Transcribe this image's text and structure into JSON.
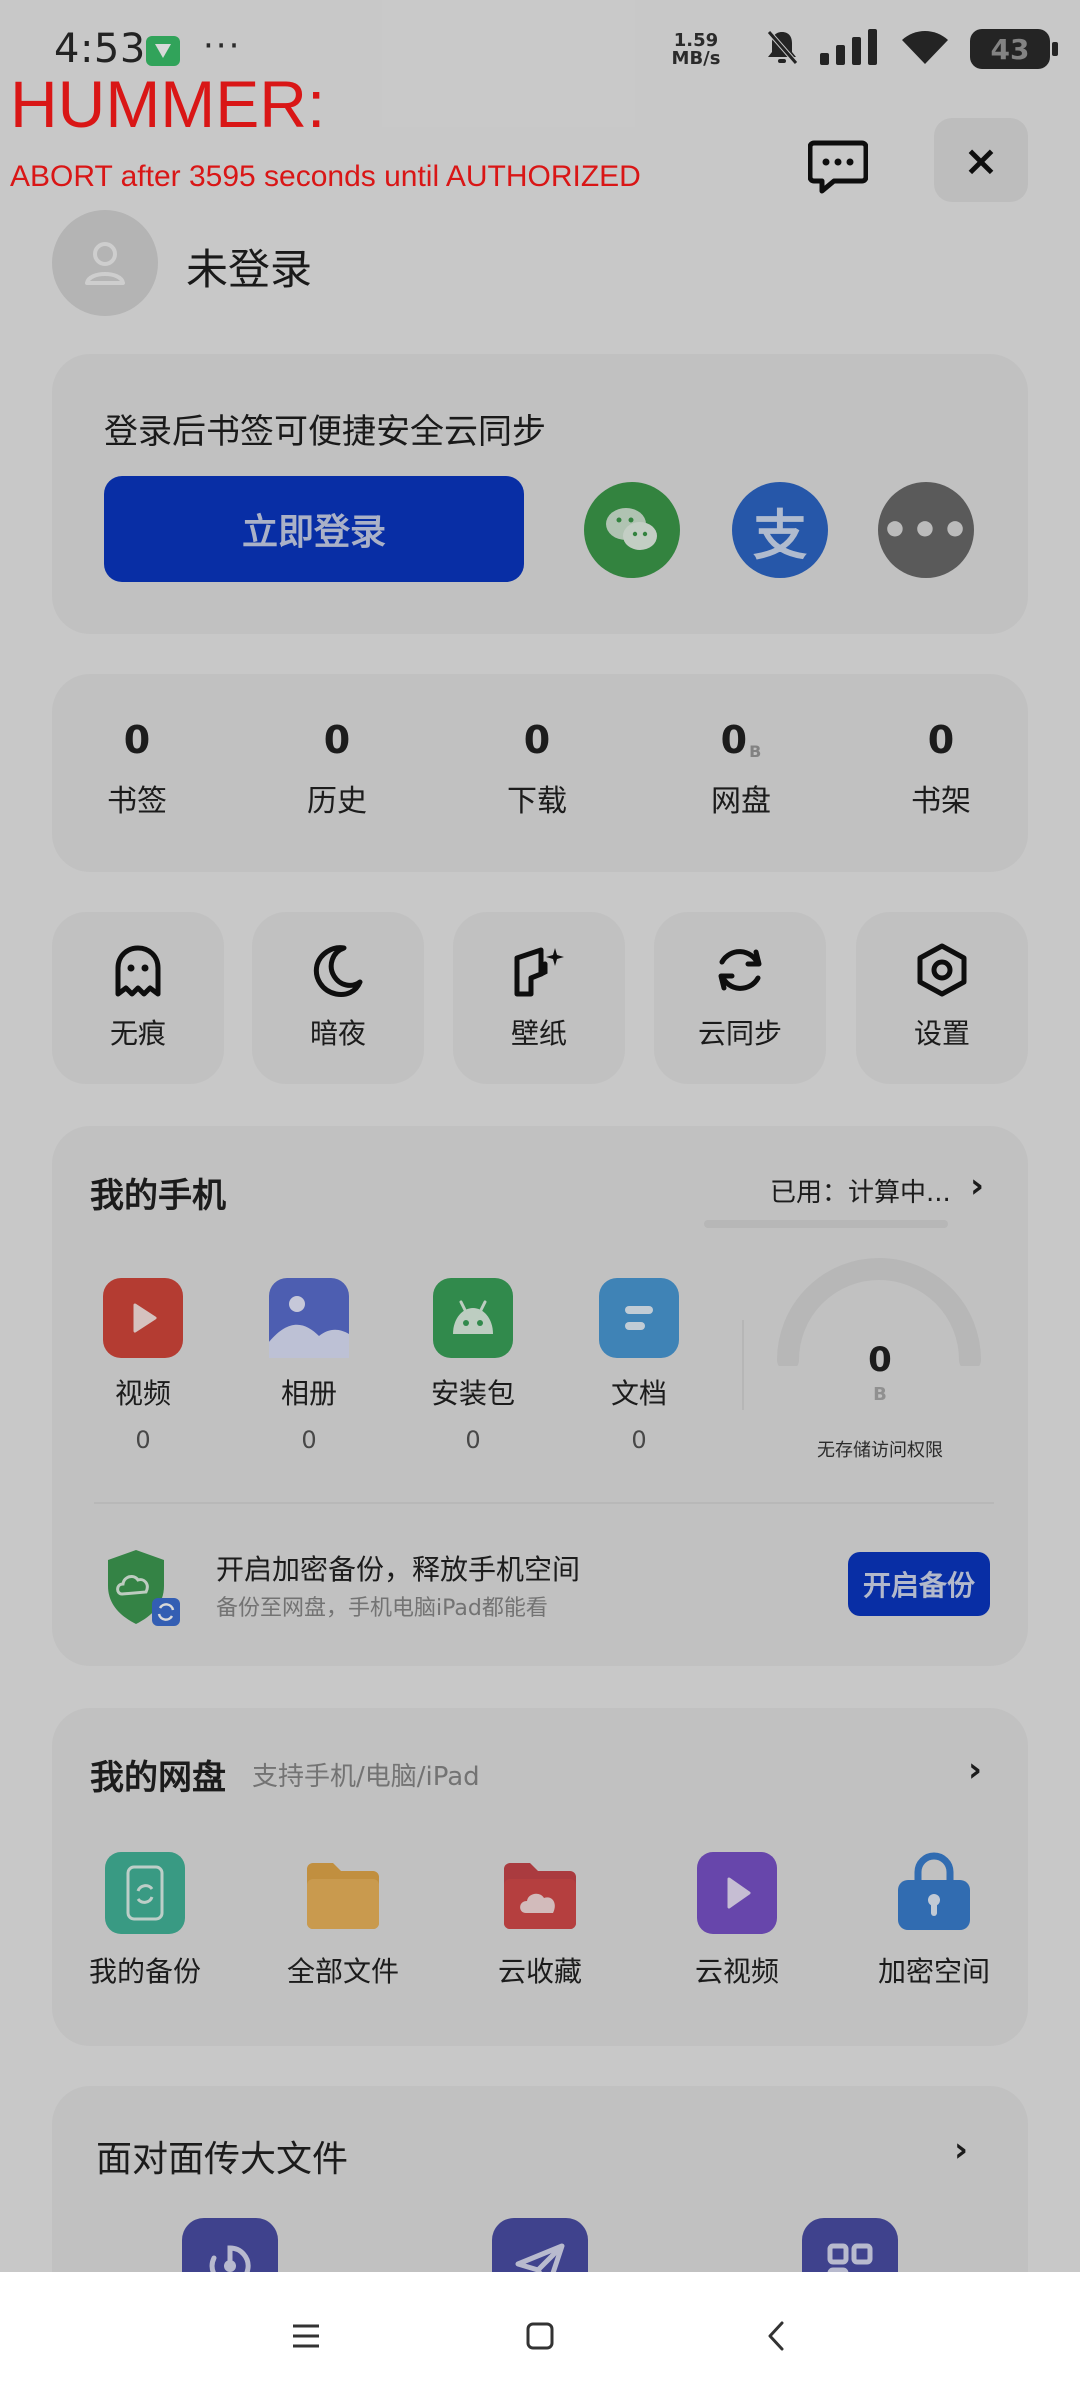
{
  "status_bar": {
    "time": "4:53",
    "dots": "···",
    "net_speed_value": "1.59",
    "net_speed_unit": "MB/s",
    "battery": "43"
  },
  "overlay": {
    "title": "HUMMER:",
    "message": "ABORT after 3595 seconds until AUTHORIZED"
  },
  "header": {
    "close_label": "×",
    "login_status": "未登录"
  },
  "login_card": {
    "hint": "登录后书签可便捷安全云同步",
    "login_button": "立即登录",
    "alipay_glyph": "支",
    "more_glyph": "•••"
  },
  "stats": [
    {
      "value": "0",
      "unit": "",
      "label": "书签"
    },
    {
      "value": "0",
      "unit": "",
      "label": "历史"
    },
    {
      "value": "0",
      "unit": "",
      "label": "下载"
    },
    {
      "value": "0",
      "unit": "B",
      "label": "网盘"
    },
    {
      "value": "0",
      "unit": "",
      "label": "书架"
    }
  ],
  "tools": [
    {
      "label": "无痕",
      "icon": "ghost-icon"
    },
    {
      "label": "暗夜",
      "icon": "moon-icon"
    },
    {
      "label": "壁纸",
      "icon": "wallpaper-icon"
    },
    {
      "label": "云同步",
      "icon": "sync-icon"
    },
    {
      "label": "设置",
      "icon": "settings-icon"
    }
  ],
  "my_phone": {
    "title": "我的手机",
    "used": "已用：计算中...",
    "arrow": "›",
    "items": [
      {
        "label": "视频",
        "count": "0",
        "icon": "video-icon",
        "color": "#d4473b"
      },
      {
        "label": "相册",
        "count": "0",
        "icon": "album-icon",
        "color": "#5b6fd0"
      },
      {
        "label": "安装包",
        "count": "0",
        "icon": "android-icon",
        "color": "#3aa35a"
      },
      {
        "label": "文档",
        "count": "0",
        "icon": "document-icon",
        "color": "#4a9ad6"
      }
    ],
    "gauge_value": "0",
    "gauge_unit": "B",
    "gauge_note": "无存储访问权限",
    "backup_title": "开启加密备份，释放手机空间",
    "backup_sub": "备份至网盘，手机电脑iPad都能看",
    "backup_button": "开启备份"
  },
  "my_disk": {
    "title": "我的网盘",
    "subtitle": "支持手机/电脑/iPad",
    "arrow": "›",
    "items": [
      {
        "label": "我的备份",
        "icon": "backup-phone-icon",
        "color": "#44b59a"
      },
      {
        "label": "全部文件",
        "icon": "folder-icon",
        "color": "#e3a84a"
      },
      {
        "label": "云收藏",
        "icon": "cloud-folder-icon",
        "color": "#d54b4b"
      },
      {
        "label": "云视频",
        "icon": "cloud-video-icon",
        "color": "#7a53c9"
      },
      {
        "label": "加密空间",
        "icon": "lock-icon",
        "color": "#3a7fd0"
      }
    ]
  },
  "face_to_face": {
    "title": "面对面传大文件",
    "arrow": "›"
  }
}
